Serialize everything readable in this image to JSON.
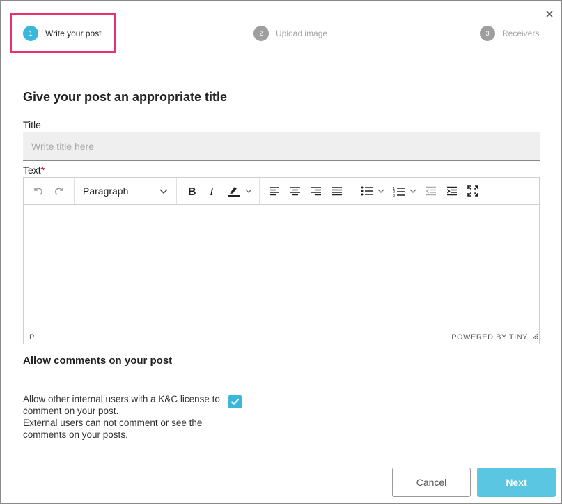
{
  "steps": [
    {
      "num": "1",
      "label": "Write your post",
      "state": "active"
    },
    {
      "num": "2",
      "label": "Upload image",
      "state": "inactive"
    },
    {
      "num": "3",
      "label": "Receivers",
      "state": "inactive"
    }
  ],
  "heading": "Give your post an appropriate title",
  "title_field": {
    "label": "Title",
    "placeholder": "Write title here",
    "value": ""
  },
  "text_field": {
    "label": "Text",
    "required_mark": "*"
  },
  "editor": {
    "format_value": "Paragraph",
    "status_path": "P",
    "branding": "POWERED BY TINY"
  },
  "comments": {
    "title": "Allow comments on your post",
    "line1": "Allow other internal users with a K&C license to comment on your post.",
    "line2": "External users can not comment or see the comments on your posts.",
    "checked": true
  },
  "buttons": {
    "cancel": "Cancel",
    "next": "Next"
  },
  "colors": {
    "accent": "#3ab8d9",
    "highlight": "#e8336a",
    "next_button": "#5bc6e2"
  },
  "icons": [
    "close-icon",
    "undo-icon",
    "redo-icon",
    "chevron-down-icon",
    "bold-icon",
    "italic-icon",
    "highlight-color-icon",
    "align-left-icon",
    "align-center-icon",
    "align-right-icon",
    "align-justify-icon",
    "bullet-list-icon",
    "numbered-list-icon",
    "outdent-icon",
    "indent-icon",
    "fullscreen-icon",
    "checkmark-icon",
    "resize-handle-icon"
  ]
}
